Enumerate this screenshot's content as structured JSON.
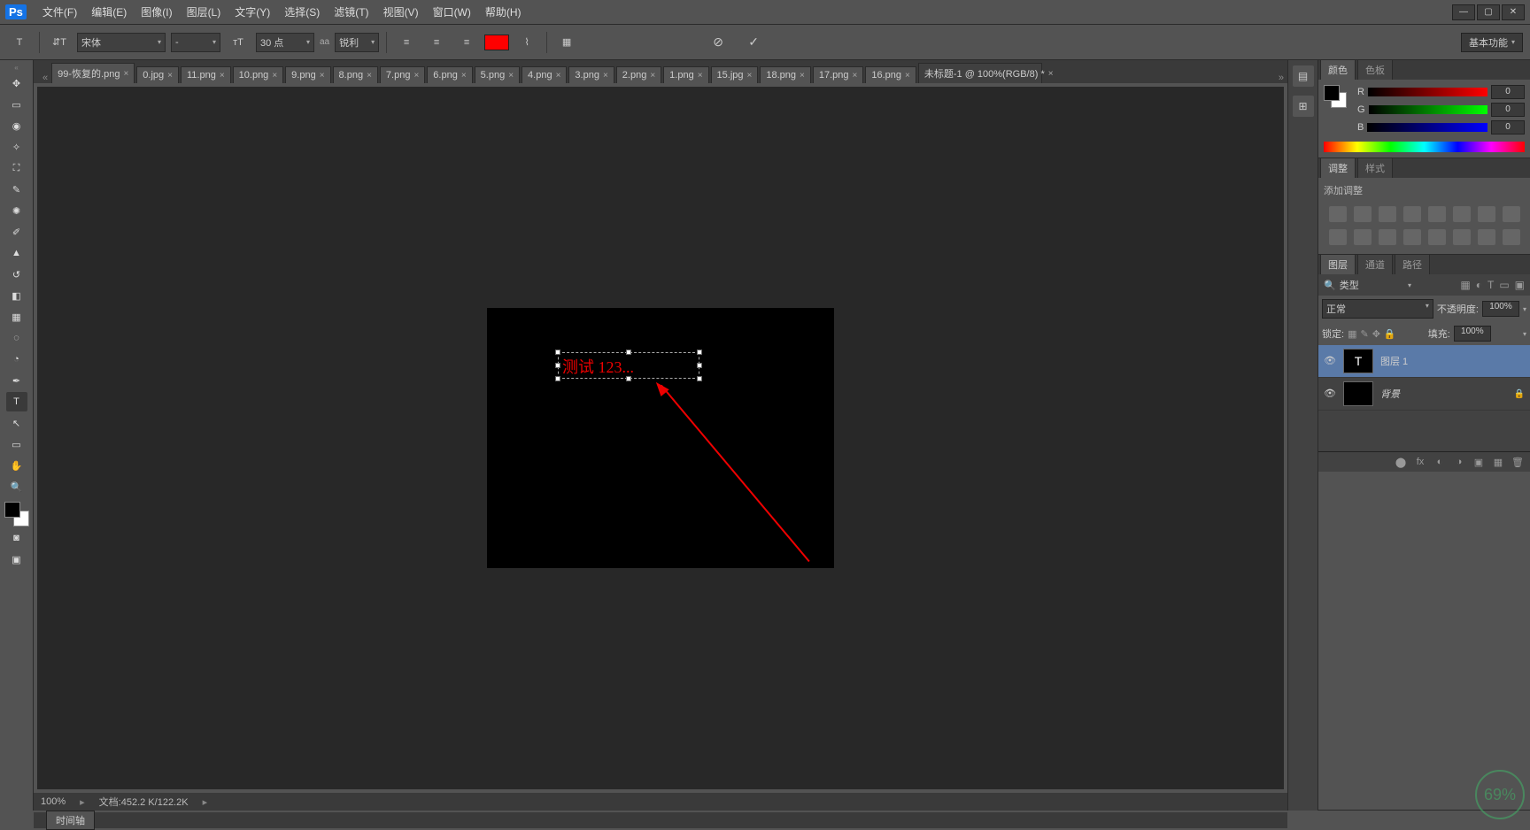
{
  "app": {
    "logo": "Ps"
  },
  "menu": [
    "文件(F)",
    "编辑(E)",
    "图像(I)",
    "图层(L)",
    "文字(Y)",
    "选择(S)",
    "滤镜(T)",
    "视图(V)",
    "窗口(W)",
    "帮助(H)"
  ],
  "options": {
    "font_family": "宋体",
    "font_style": "-",
    "font_size": "30 点",
    "aa_label": "aa",
    "antialias": "锐利",
    "text_color": "#ff0000"
  },
  "basic_fn": "基本功能",
  "tabs": [
    {
      "label": "99-恢复的.png"
    },
    {
      "label": "0.jpg"
    },
    {
      "label": "11.png"
    },
    {
      "label": "10.png"
    },
    {
      "label": "9.png"
    },
    {
      "label": "8.png"
    },
    {
      "label": "7.png"
    },
    {
      "label": "6.png"
    },
    {
      "label": "5.png"
    },
    {
      "label": "4.png"
    },
    {
      "label": "3.png"
    },
    {
      "label": "2.png"
    },
    {
      "label": "1.png"
    },
    {
      "label": "15.jpg"
    },
    {
      "label": "18.png"
    },
    {
      "label": "17.png"
    },
    {
      "label": "16.png"
    },
    {
      "label": "未标题-1 @ 100%(RGB/8) *",
      "active": true
    }
  ],
  "canvas": {
    "text": "测试 123..."
  },
  "status": {
    "zoom": "100%",
    "doc_info": "文档:452.2 K/122.2K"
  },
  "timeline": "时间轴",
  "panels": {
    "color": {
      "tab_color": "颜色",
      "tab_swatches": "色板",
      "r_label": "R",
      "r_val": "0",
      "g_label": "G",
      "g_val": "0",
      "b_label": "B",
      "b_val": "0"
    },
    "adjust": {
      "tab_adjust": "调整",
      "tab_styles": "样式",
      "add_label": "添加调整"
    },
    "layers": {
      "tab_layers": "图层",
      "tab_channels": "通道",
      "tab_paths": "路径",
      "filter_label": "类型",
      "blend_mode": "正常",
      "opacity_label": "不透明度:",
      "opacity_val": "100%",
      "lock_label": "锁定:",
      "fill_label": "填充:",
      "fill_val": "100%",
      "items": [
        {
          "name": "图层 1",
          "thumb": "T",
          "selected": true
        },
        {
          "name": "背景",
          "thumb": "",
          "locked": true
        }
      ]
    }
  },
  "watermark": {
    "badge": "69%"
  }
}
